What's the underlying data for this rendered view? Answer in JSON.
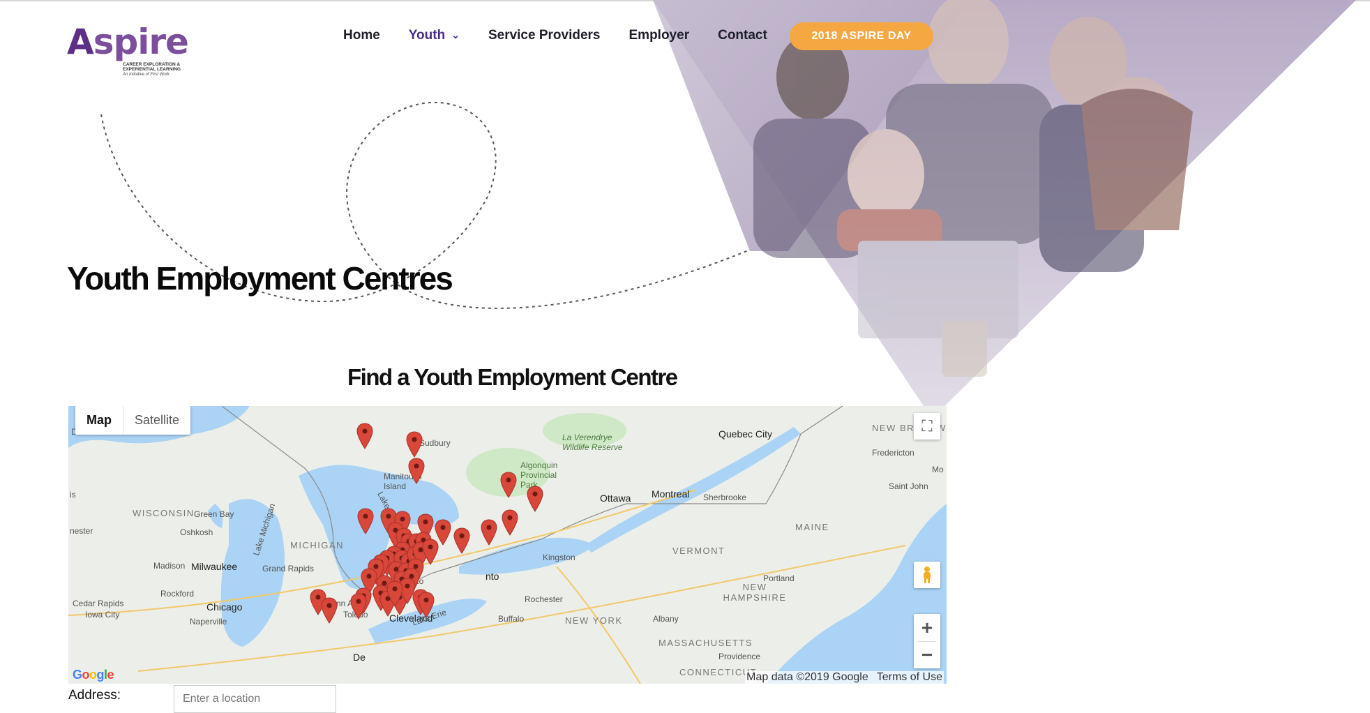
{
  "logo": {
    "word_cap": "A",
    "word_rest": "spire",
    "subtitle": "Career Exploration & Experiential Learning",
    "tagline": "An Initiative of First Work"
  },
  "nav": {
    "items": [
      {
        "label": "Home"
      },
      {
        "label": "Youth",
        "active": true
      },
      {
        "label": "Service Providers"
      },
      {
        "label": "Employer"
      },
      {
        "label": "Contact"
      }
    ],
    "cta_label": "2018 ASPIRE DAY"
  },
  "page_title": "Youth Employment Centres",
  "section_title": "Find a Youth Employment Centre",
  "map": {
    "type_buttons": {
      "map": "Map",
      "satellite": "Satellite"
    },
    "labels": {
      "duluth": "Duluth",
      "sudbury": "Sudbury",
      "wisconsin": "WISCONSIN",
      "michigan": "MICHIGAN",
      "green_bay": "Green Bay",
      "oshkosh": "Oshkosh",
      "milwaukee": "Milwaukee",
      "madison": "Madison",
      "grand_rapids": "Grand Rapids",
      "chicago": "Chicago",
      "rockford": "Rockford",
      "cedar_rapids": "Cedar Rapids",
      "iowa_city": "Iowa City",
      "naperville": "Naperville",
      "ann_arbor": "Ann Arbor",
      "toledo": "Toledo",
      "cleveland": "Cleveland",
      "lake_michigan": "Lake Michigan",
      "lake_huron": "Lake Huron",
      "lake_erie": "Lake Erie",
      "manitoulin": "Manitoulin Island",
      "algonquin": "Algonquin Provincial Park",
      "ottawa": "Ottawa",
      "montreal": "Montreal",
      "quebec_city": "Quebec City",
      "la_verendrye": "La Verendrye Wildlife Reserve",
      "sherbrooke": "Sherbrooke",
      "kingston": "Kingston",
      "rochester": "Rochester",
      "buffalo": "Buffalo",
      "new_york": "NEW YORK",
      "vermont": "VERMONT",
      "albany": "Albany",
      "maine": "MAINE",
      "new_hampshire": "NEW HAMPSHIRE",
      "massachusetts": "MASSACHUSETTS",
      "connecticut": "CONNECTICUT",
      "portland": "Portland",
      "providence": "Providence",
      "fredericton": "Fredericton",
      "saint_john": "Saint John",
      "new_brunswick": "NEW BRUNSWICK",
      "toronto_frag": "nto",
      "detroit_frag": "De",
      "london_frag": "Lo",
      "is_frag": "is",
      "nester_frag": "nester",
      "mo_frag": "Mo"
    },
    "attribution": {
      "data": "Map data ©2019 Google",
      "terms": "Terms of Use"
    },
    "google": "Google"
  },
  "address": {
    "label": "Address:",
    "placeholder": "Enter a location"
  },
  "colors": {
    "accent": "#4b2a8a",
    "cta": "#f5a742",
    "pin": "#d9463a",
    "water": "#aad3f5"
  }
}
